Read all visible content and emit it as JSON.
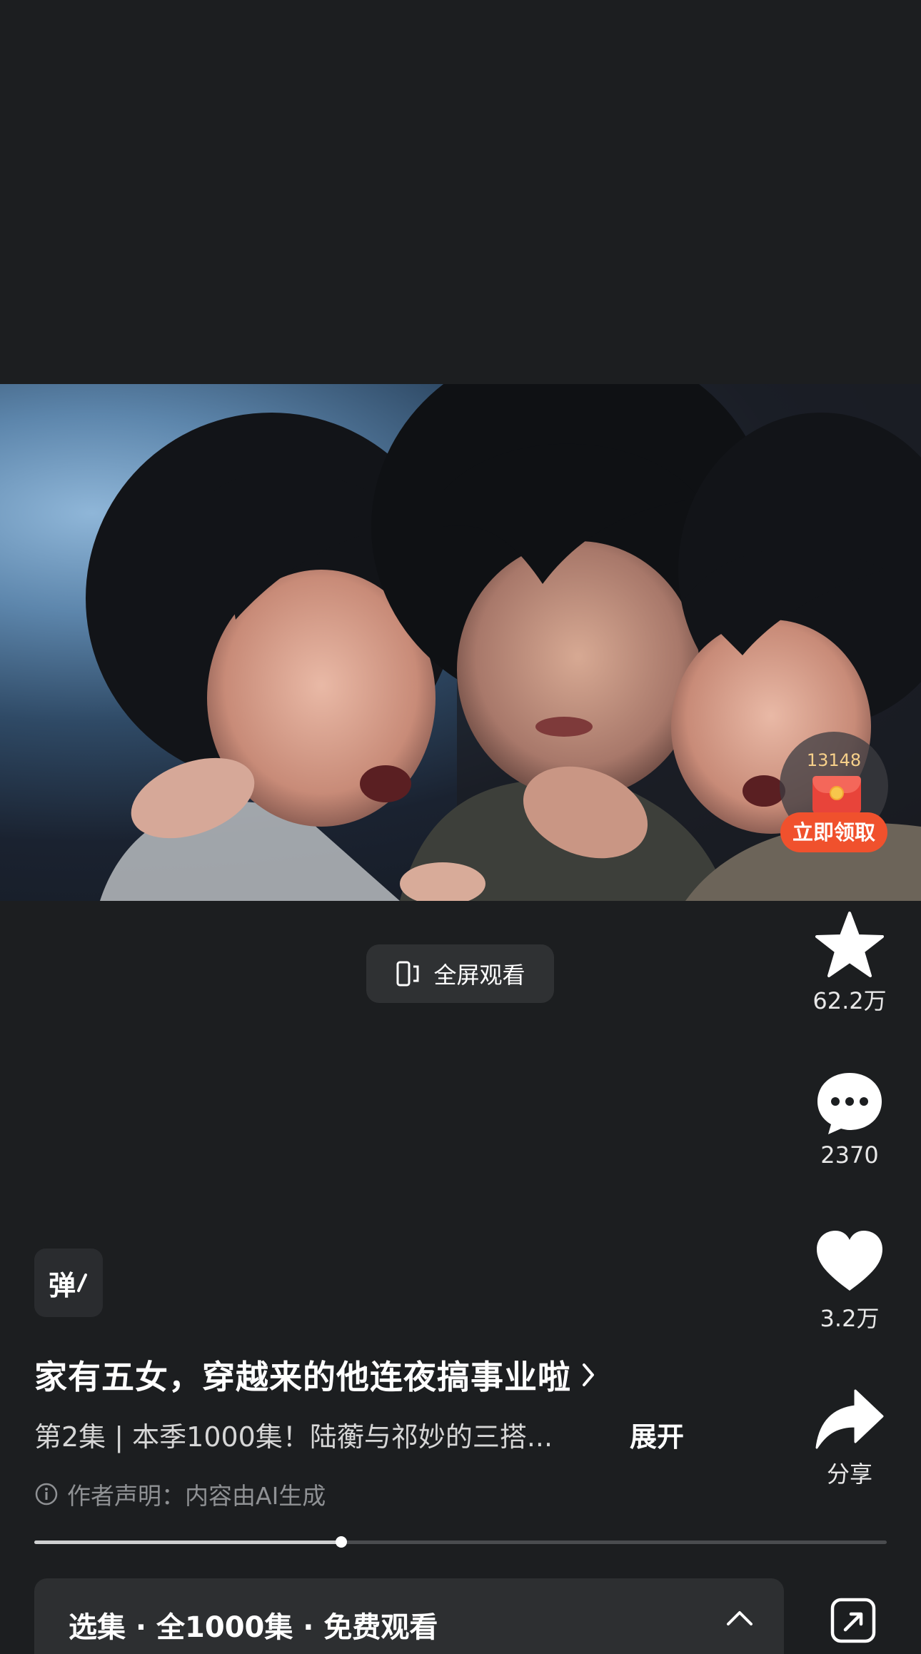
{
  "video": {
    "description_alt": ""
  },
  "red_packet": {
    "count": "13148",
    "claim_label": "立即领取"
  },
  "fullscreen": {
    "label": "全屏观看"
  },
  "actions": {
    "favorite_count": "62.2万",
    "comment_count": "2370",
    "like_count": "3.2万",
    "share_label": "分享"
  },
  "danmaku": {
    "label": "弹"
  },
  "info": {
    "title": "家有五女，穿越来的他连夜搞事业啦",
    "description": "第2集 | 本季1000集！陆蘅与祁妙的三搭...",
    "expand_label": "展开",
    "notice": "作者声明：内容由AI生成"
  },
  "playback": {
    "progress": 0.36
  },
  "episodes": {
    "label": "选集 · 全1000集 · 免费观看"
  },
  "colors": {
    "background": "#1c1e20",
    "accent_red": "#f0512d",
    "coin_gold": "#f7d08a"
  }
}
